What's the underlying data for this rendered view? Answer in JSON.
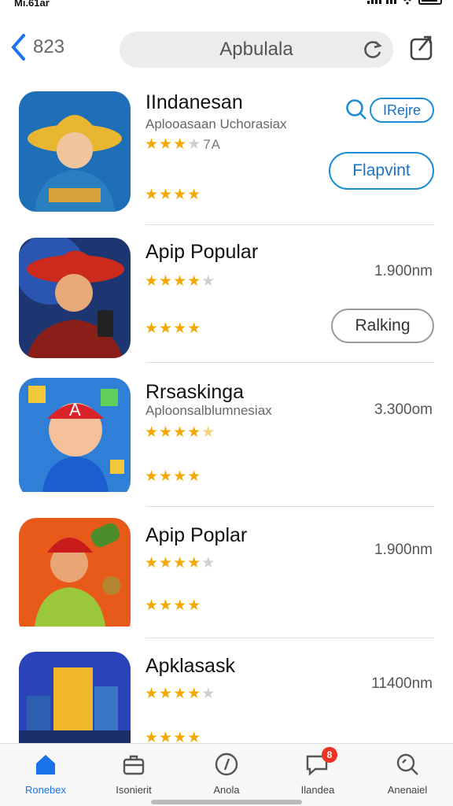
{
  "status": {
    "carrier": "Mi.61ar"
  },
  "nav": {
    "back_count": "823",
    "search_text": "Apbulala"
  },
  "apps": [
    {
      "title": "IIndanesan",
      "subtitle": "Aplooasaan Uchorasiax",
      "rating": 3.5,
      "rating_text": "7A",
      "rating2": 4,
      "tag_label": "IRejre",
      "action_label": "Flapvint",
      "size": ""
    },
    {
      "title": "Apip Popular",
      "subtitle": "",
      "rating": 4,
      "rating2": 4,
      "size": "1.900nm",
      "action_label": "Ralking"
    },
    {
      "title": "Rrsaskinga",
      "subtitle": "Aploonsalblumnesiax",
      "rating": 4.5,
      "rating2": 4,
      "size": "3.300om"
    },
    {
      "title": "Apip Poplar",
      "subtitle": "",
      "rating": 4,
      "rating2": 4,
      "size": "1.900nm"
    },
    {
      "title": "Apklasask",
      "subtitle": "",
      "rating": 4,
      "rating2": 4,
      "size": "11400nm"
    }
  ],
  "tabs": [
    {
      "label": "Ronebex",
      "icon": "home-icon",
      "active": true
    },
    {
      "label": "Isonierit",
      "icon": "briefcase-icon"
    },
    {
      "label": "Anola",
      "icon": "compass-icon"
    },
    {
      "label": "Ilandea",
      "icon": "chat-icon",
      "badge": "8"
    },
    {
      "label": "Anenaiel",
      "icon": "search-icon"
    }
  ],
  "colors": {
    "accent": "#1a73e8",
    "star": "#f4a900",
    "badge": "#e33322"
  }
}
